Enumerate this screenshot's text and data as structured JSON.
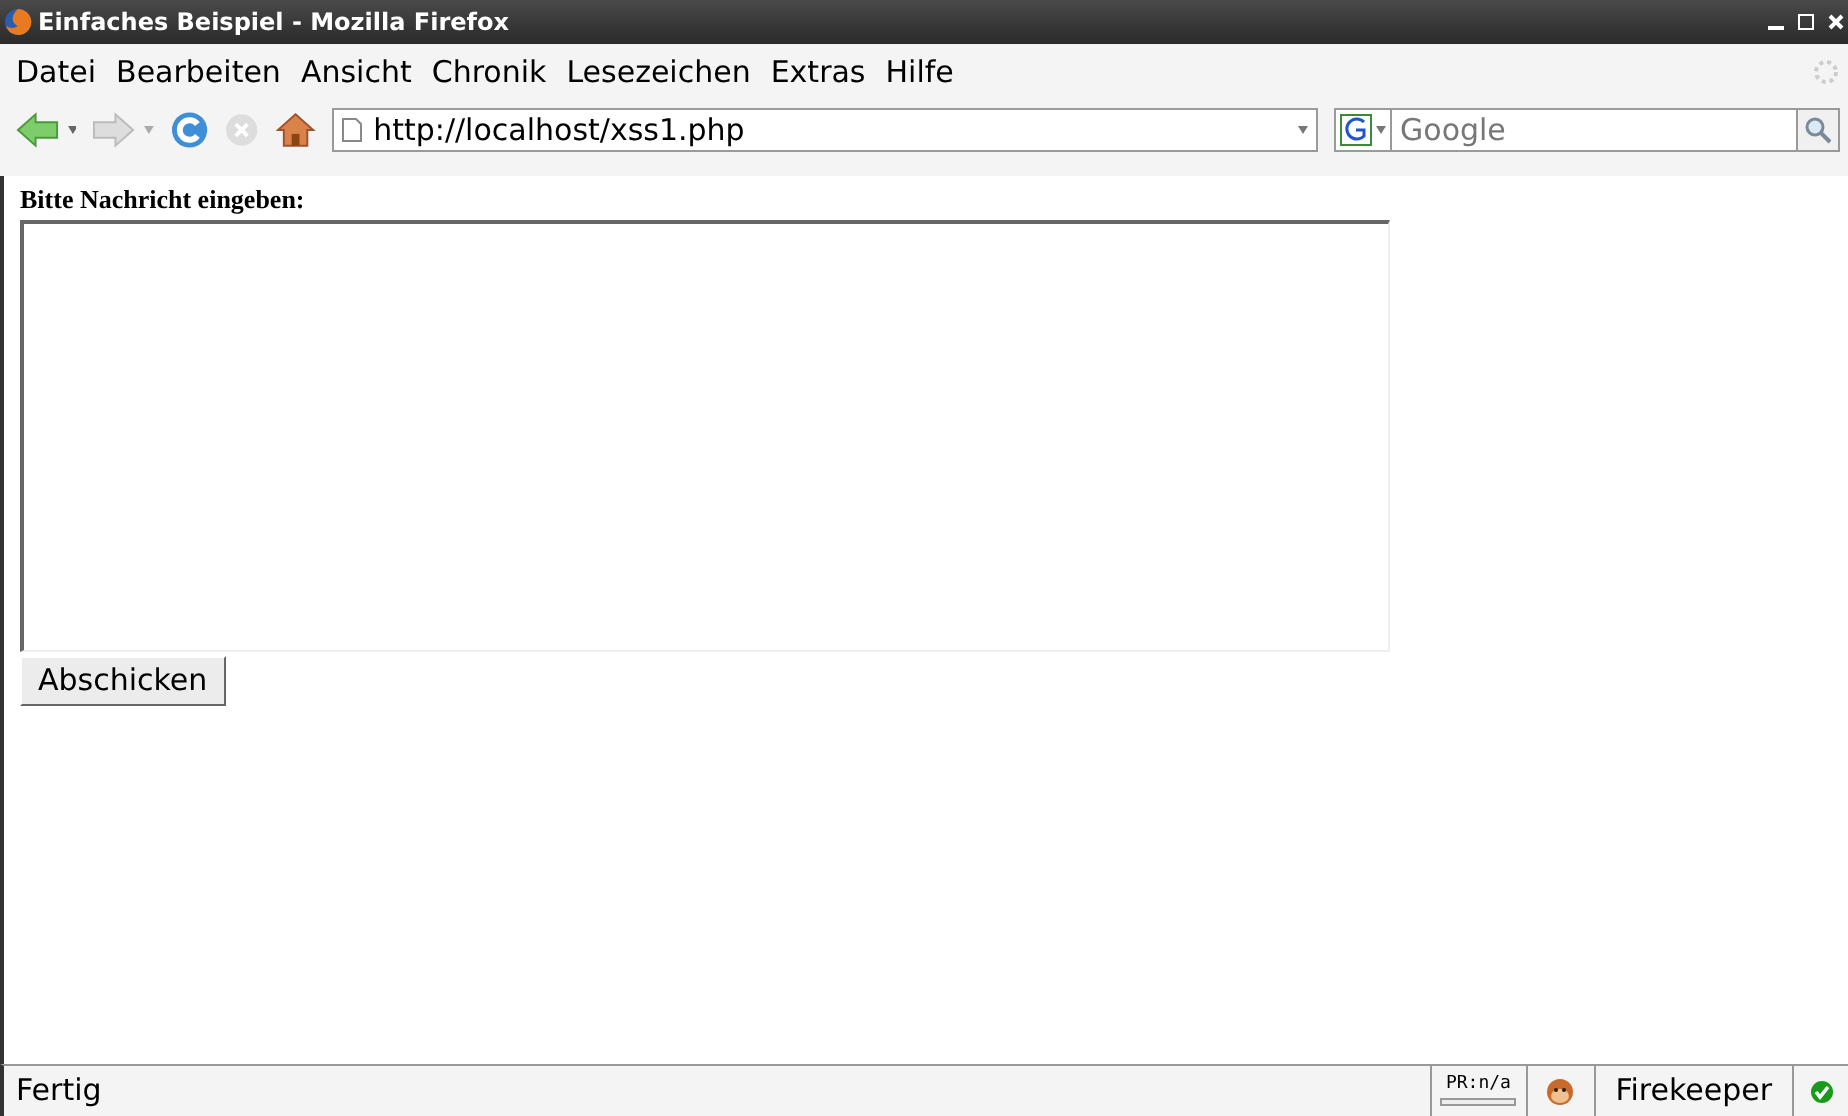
{
  "window": {
    "title": "Einfaches Beispiel - Mozilla Firefox"
  },
  "menu": [
    "Datei",
    "Bearbeiten",
    "Ansicht",
    "Chronik",
    "Lesezeichen",
    "Extras",
    "Hilfe"
  ],
  "address_bar": {
    "value": "http://localhost/xss1.php"
  },
  "search": {
    "placeholder": "Google"
  },
  "page": {
    "label": "Bitte Nachricht eingeben:",
    "button": "Abschicken"
  },
  "status_bar": {
    "text": "Fertig",
    "pagerank": "PR:n/a",
    "extension": "Firekeeper"
  }
}
